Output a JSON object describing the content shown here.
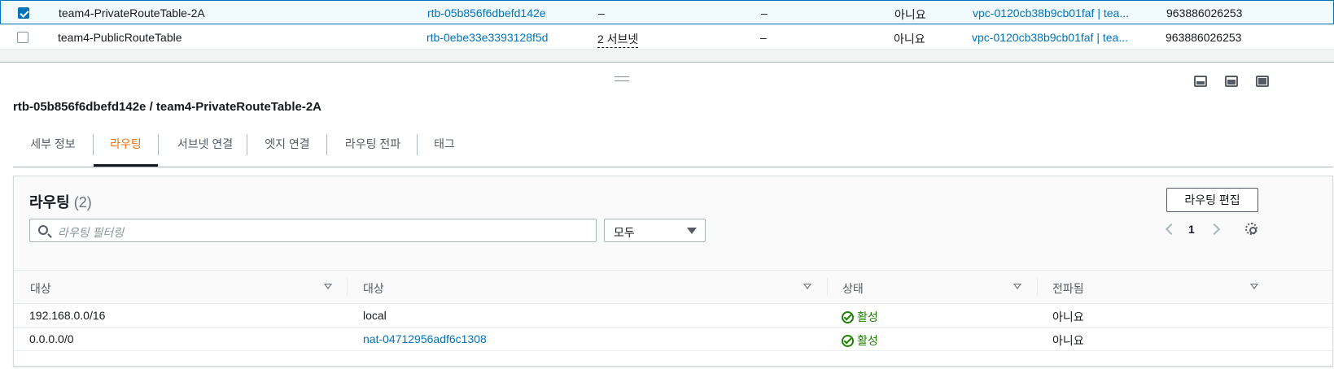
{
  "route_tables": {
    "rows": [
      {
        "checked": true,
        "name": "team4-PrivateRouteTable-2A",
        "id": "rtb-05b856f6dbefd142e",
        "explicit_subnets": "–",
        "edge_associations": "–",
        "main": "아니요",
        "vpc": "vpc-0120cb38b9cb01faf | tea...",
        "owner": "963886026253"
      },
      {
        "checked": false,
        "name": "team4-PublicRouteTable",
        "id": "rtb-0ebe33e3393128f5d",
        "explicit_subnets": "2 서브넷",
        "edge_associations": "–",
        "main": "아니요",
        "vpc": "vpc-0120cb38b9cb01faf | tea...",
        "owner": "963886026253"
      }
    ]
  },
  "detail": {
    "title": "rtb-05b856f6dbefd142e / team4-PrivateRouteTable-2A",
    "tabs": [
      {
        "label": "세부 정보",
        "active": false
      },
      {
        "label": "라우팅",
        "active": true
      },
      {
        "label": "서브넷 연결",
        "active": false
      },
      {
        "label": "엣지 연결",
        "active": false
      },
      {
        "label": "라우팅 전파",
        "active": false
      },
      {
        "label": "태그",
        "active": false
      }
    ]
  },
  "routes": {
    "title": "라우팅",
    "count": "(2)",
    "edit_label": "라우팅 편집",
    "search_placeholder": "라우팅 필터링",
    "filter_value": "모두",
    "page": "1",
    "columns": [
      "대상",
      "대상",
      "상태",
      "전파됨"
    ],
    "rows": [
      {
        "destination": "192.168.0.0/16",
        "target": "local",
        "target_is_link": false,
        "status": "활성",
        "propagated": "아니요"
      },
      {
        "destination": "0.0.0.0/0",
        "target": "nat-04712956adf6c1308",
        "target_is_link": true,
        "status": "활성",
        "propagated": "아니요"
      }
    ]
  },
  "colors": {
    "link": "#0073bb",
    "active_tab": "#ec7211",
    "status_ok": "#1d8102",
    "selected_row_bg": "#f1faff"
  }
}
